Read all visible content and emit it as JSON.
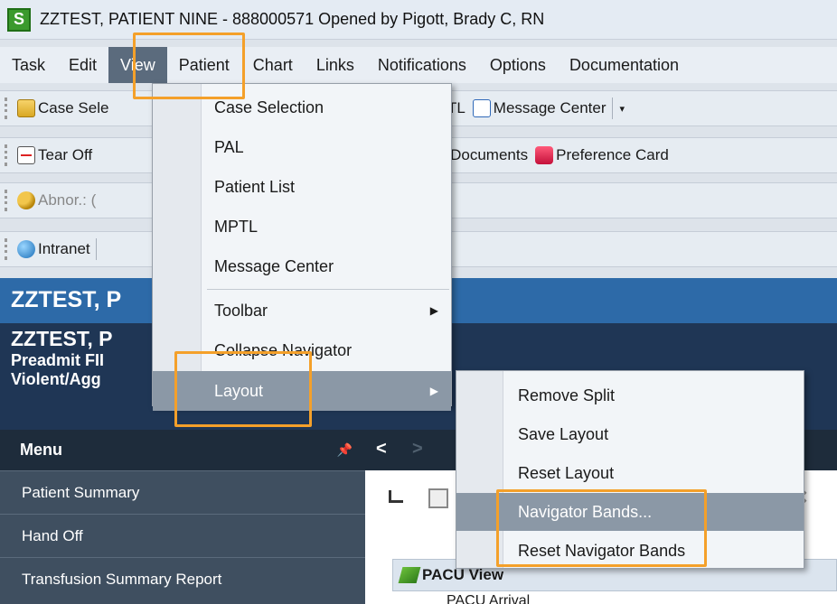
{
  "window": {
    "title": "ZZTEST, PATIENT NINE - 888000571 Opened by Pigott, Brady C, RN",
    "logo_letter": "S"
  },
  "menubar": [
    "Task",
    "Edit",
    "View",
    "Patient",
    "Chart",
    "Links",
    "Notifications",
    "Options",
    "Documentation"
  ],
  "toolbars": {
    "row1": {
      "case_selection": "Case Sele",
      "mptl": "MPTL",
      "message_center": "Message Center"
    },
    "row2": {
      "tear_off": "Tear Off",
      "doc": "oc",
      "documents": "Documents",
      "preference_card": "Preference Card"
    },
    "row3": {
      "abnormal": "Abnor.: ("
    },
    "row4": {
      "intranet": "Intranet"
    }
  },
  "banner": {
    "name_top": "ZZTEST, P",
    "name_second": "ZZTEST, P",
    "line1": "Preadmit FII",
    "line2": "Violent/Agg"
  },
  "left_menu": {
    "header": "Menu",
    "items": [
      "Patient Summary",
      "Hand Off",
      "Transfusion Summary Report"
    ]
  },
  "content": {
    "pacu_view": "PACU View",
    "pacu_arrival": "PACU Arrival"
  },
  "view_menu": {
    "items": [
      "Case Selection",
      "PAL",
      "Patient List",
      "MPTL",
      "Message Center",
      "Toolbar",
      "Collapse Navigator",
      "Layout"
    ]
  },
  "layout_submenu": {
    "items": [
      "Remove Split",
      "Save Layout",
      "Reset Layout",
      "Navigator Bands...",
      "Reset Navigator Bands"
    ]
  },
  "colors": {
    "highlight_annotation": "#f4a02a",
    "banner": "#1f3655",
    "menu_panel": "#3f4f60"
  }
}
